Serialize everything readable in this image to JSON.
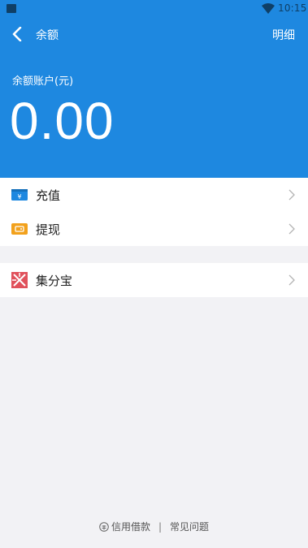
{
  "status_bar": {
    "time": "10:15"
  },
  "header": {
    "title": "余额",
    "detail_label": "明细"
  },
  "balance": {
    "label": "余额账户(元)",
    "value": "0.00"
  },
  "menu": {
    "recharge_label": "充值",
    "withdraw_label": "提现",
    "jifenbao_label": "集分宝"
  },
  "footer": {
    "credit_link": "信用借款",
    "separator": "|",
    "faq_link": "常见问题"
  },
  "colors": {
    "primary": "#1e88e0",
    "recharge_icon": "#1e88e0",
    "withdraw_icon": "#f2a11c",
    "jifenbao_icon": "#e0515b"
  }
}
